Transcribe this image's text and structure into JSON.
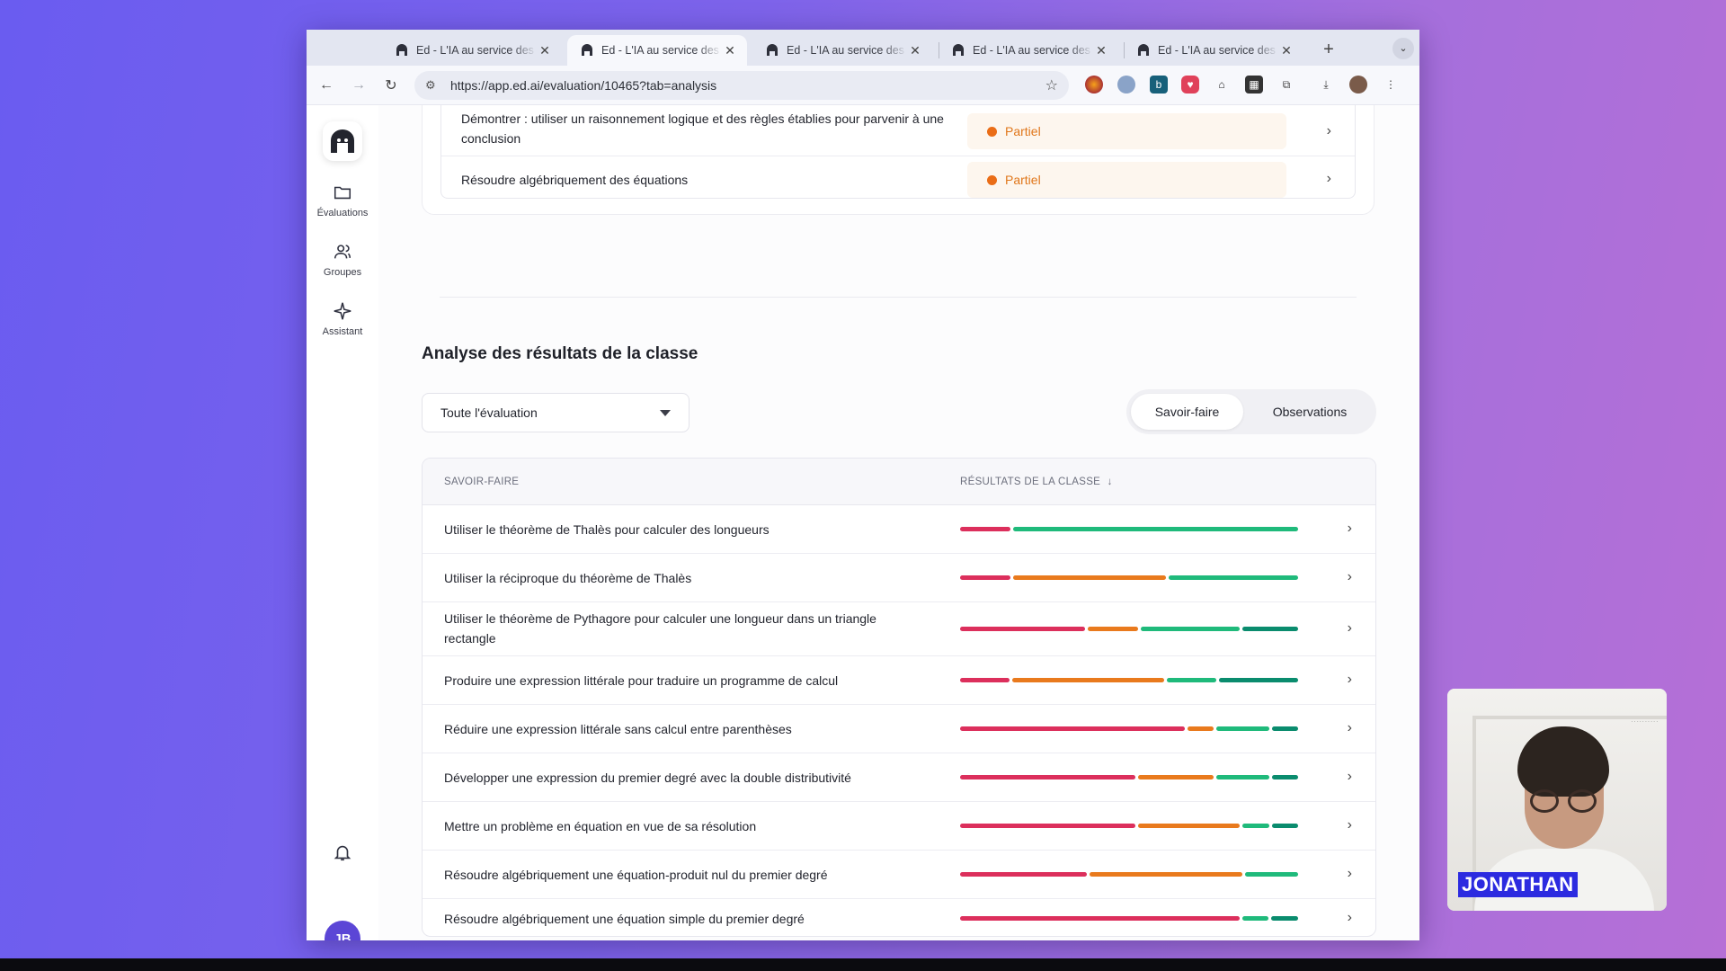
{
  "browser": {
    "tabs": [
      {
        "title": "Ed - L'IA au service des enseignants",
        "active": false
      },
      {
        "title": "Ed - L'IA au service des enseignants",
        "active": true
      },
      {
        "title": "Ed - L'IA au service des enseignants",
        "active": false
      },
      {
        "title": "Ed - L'IA au service des enseignants",
        "active": false
      },
      {
        "title": "Ed - L'IA au service des enseignants",
        "active": false
      }
    ],
    "url": "https://app.ed.ai/evaluation/10465?tab=analysis"
  },
  "sidebar": {
    "items": [
      {
        "label": "Évaluations",
        "icon": "folder-icon"
      },
      {
        "label": "Groupes",
        "icon": "users-icon"
      },
      {
        "label": "Assistant",
        "icon": "sparkle-icon"
      }
    ],
    "avatar_initials": "JB"
  },
  "criteria": [
    {
      "text": "Démontrer : utiliser un raisonnement logique et des règles établies pour parvenir à une conclusion",
      "status": "Partiel"
    },
    {
      "text": "Résoudre algébriquement des équations",
      "status": "Partiel"
    }
  ],
  "analysis": {
    "title": "Analyse des résultats de la classe",
    "filter_value": "Toute l'évaluation",
    "toggle": [
      "Savoir-faire",
      "Observations"
    ],
    "toggle_active": "Savoir-faire",
    "columns": {
      "skill": "SAVOIR-FAIRE",
      "results": "RÉSULTATS DE LA CLASSE"
    },
    "sort_icon": "arrow-down-icon"
  },
  "colors": {
    "red": "#dc2f5c",
    "orange": "#e97a1d",
    "green": "#1fba7b",
    "teal": "#0a8c6e",
    "partiel": "#ea6d17"
  },
  "chart_data": {
    "type": "bar",
    "stacked": true,
    "series_order": [
      "red",
      "orange",
      "green",
      "teal"
    ],
    "rows": [
      {
        "label": "Utiliser le théorème de Thalès pour calculer des longueurs",
        "values": [
          0.15,
          0,
          0.85,
          0
        ]
      },
      {
        "label": "Utiliser la réciproque du théorème de Thalès",
        "values": [
          0.15,
          0.46,
          0.39,
          0
        ]
      },
      {
        "label": "Utiliser le théorème de Pythagore pour calculer une longueur dans un triangle rectangle",
        "values": [
          0.38,
          0.15,
          0.3,
          0.17
        ]
      },
      {
        "label": "Produire une expression littérale pour traduire un programme de calcul",
        "values": [
          0.15,
          0.46,
          0.15,
          0.24
        ]
      },
      {
        "label": "Réduire une expression littérale sans calcul entre parenthèses",
        "values": [
          0.68,
          0.08,
          0.16,
          0.08
        ]
      },
      {
        "label": "Développer une expression du premier degré avec la double distributivité",
        "values": [
          0.53,
          0.23,
          0.16,
          0.08
        ]
      },
      {
        "label": "Mettre un problème en équation en vue de sa résolution",
        "values": [
          0.53,
          0.31,
          0.08,
          0.08
        ]
      },
      {
        "label": "Résoudre algébriquement une équation-produit nul du premier degré",
        "values": [
          0.38,
          0.46,
          0.16,
          0
        ]
      },
      {
        "label": "Résoudre algébriquement une équation simple du premier degré",
        "values": [
          0.84,
          0,
          0.08,
          0.08
        ]
      }
    ]
  },
  "webcam": {
    "name": "JONATHAN"
  }
}
